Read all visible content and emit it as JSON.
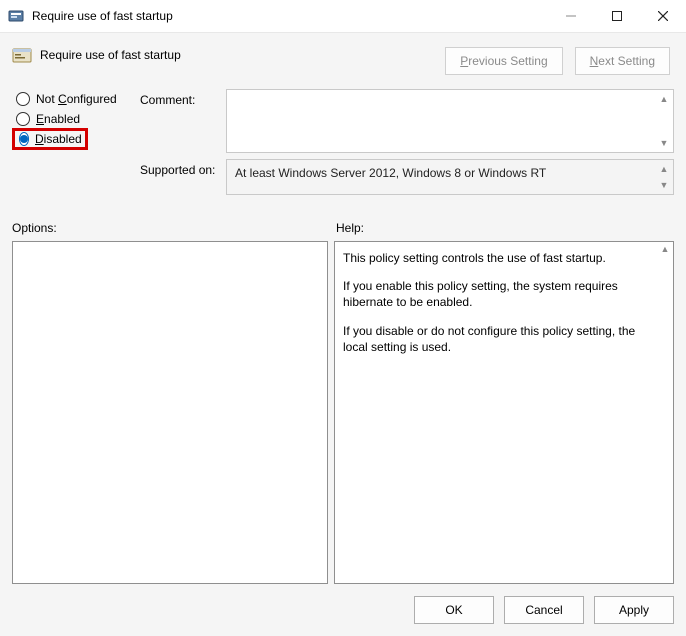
{
  "titlebar": {
    "title": "Require use of fast startup"
  },
  "header": {
    "policy_title": "Require use of fast startup"
  },
  "nav": {
    "prev": "Previous Setting",
    "next": "Next Setting"
  },
  "radios": {
    "not_configured": "Not Configured",
    "enabled": "Enabled",
    "disabled": "Disabled",
    "selected": "disabled"
  },
  "labels": {
    "comment": "Comment:",
    "supported": "Supported on:",
    "options": "Options:",
    "help": "Help:"
  },
  "comment_value": "",
  "supported_text": "At least Windows Server 2012, Windows 8 or Windows RT",
  "help": {
    "p1": "This policy setting controls the use of fast startup.",
    "p2": "If you enable this policy setting, the system requires hibernate to be enabled.",
    "p3": "If you disable or do not configure this policy setting, the local setting is used."
  },
  "footer": {
    "ok": "OK",
    "cancel": "Cancel",
    "apply": "Apply"
  }
}
